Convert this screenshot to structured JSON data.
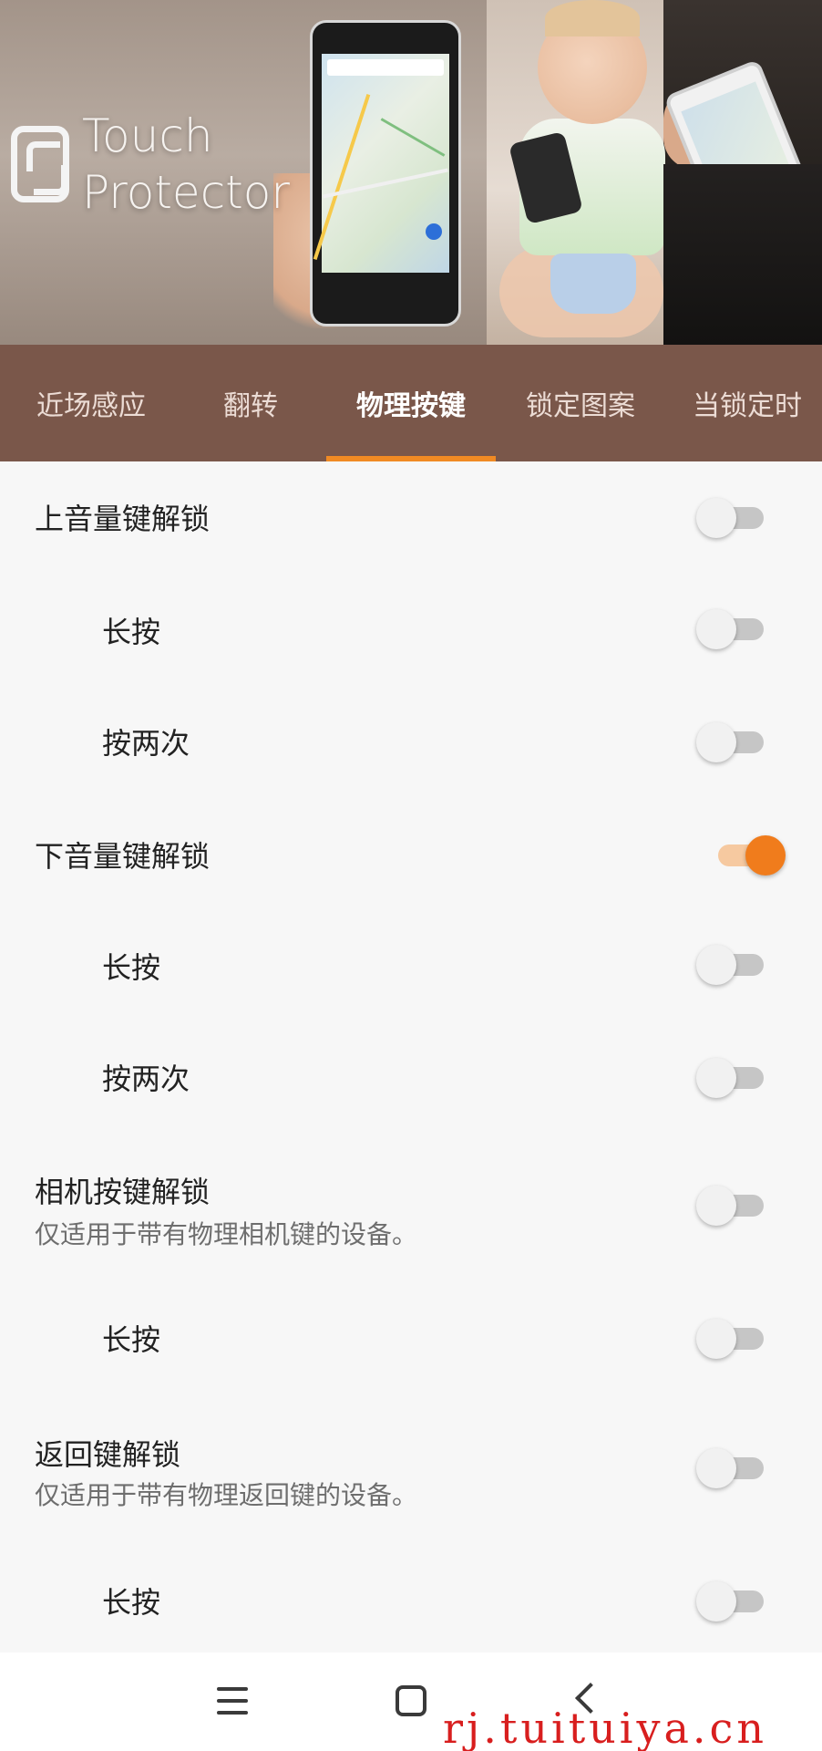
{
  "hero": {
    "brand_line1": "Touch",
    "brand_line2": "Protector"
  },
  "tabs": [
    {
      "label": "近场感应",
      "active": false
    },
    {
      "label": "翻转",
      "active": false
    },
    {
      "label": "物理按键",
      "active": true
    },
    {
      "label": "锁定图案",
      "active": false
    },
    {
      "label": "当锁定时",
      "active": false
    }
  ],
  "settings": [
    {
      "title": "上音量键解锁",
      "subtitle": "",
      "enabled": false,
      "indented": false
    },
    {
      "title": "长按",
      "subtitle": "",
      "enabled": false,
      "indented": true
    },
    {
      "title": "按两次",
      "subtitle": "",
      "enabled": false,
      "indented": true
    },
    {
      "title": "下音量键解锁",
      "subtitle": "",
      "enabled": true,
      "indented": false
    },
    {
      "title": "长按",
      "subtitle": "",
      "enabled": false,
      "indented": true
    },
    {
      "title": "按两次",
      "subtitle": "",
      "enabled": false,
      "indented": true
    },
    {
      "title": "相机按键解锁",
      "subtitle": "仅适用于带有物理相机键的设备。",
      "enabled": false,
      "indented": false
    },
    {
      "title": "长按",
      "subtitle": "",
      "enabled": false,
      "indented": true
    },
    {
      "title": "返回键解锁",
      "subtitle": "仅适用于带有物理返回键的设备。",
      "enabled": false,
      "indented": false
    },
    {
      "title": "长按",
      "subtitle": "",
      "enabled": false,
      "indented": true
    }
  ],
  "navbar": {
    "icons": [
      "menu-icon",
      "home-icon",
      "back-icon"
    ]
  },
  "watermark": "rj.tuituiya.cn",
  "colors": {
    "tabbar": "#7a574a",
    "accent": "#f08a24",
    "switch_on": "#f07c1c"
  }
}
